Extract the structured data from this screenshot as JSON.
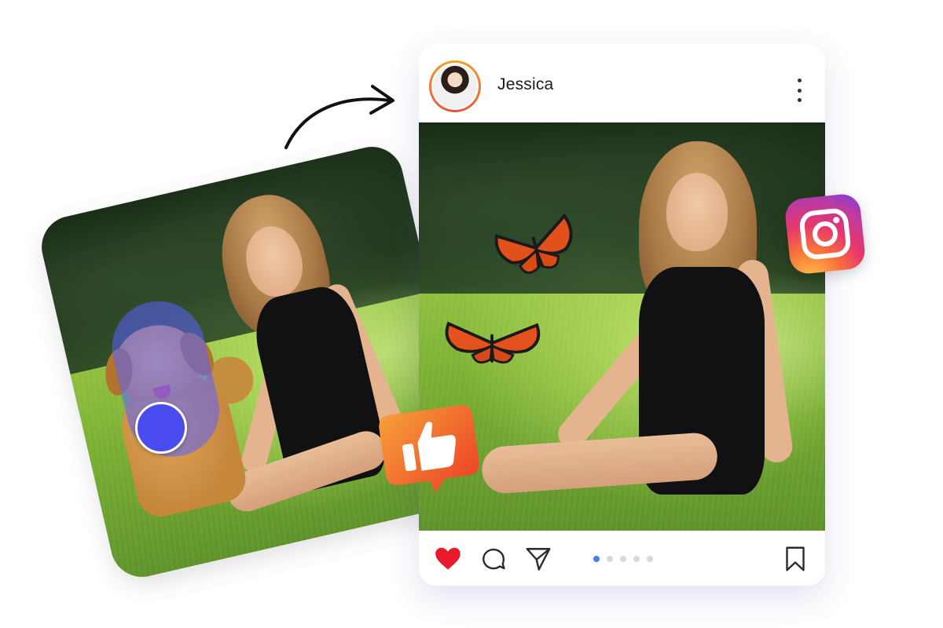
{
  "post": {
    "username": "Jessica",
    "carousel": {
      "count": 5,
      "active": 1
    }
  },
  "icons": {
    "more": "more-vertical-icon",
    "like": "heart-icon",
    "comment": "comment-icon",
    "share": "send-icon",
    "save": "bookmark-icon",
    "badge_like": "thumbs-up-icon",
    "badge_social": "instagram-icon",
    "arrow": "curved-arrow-icon"
  },
  "colors": {
    "heart": "#e8192c",
    "mask": "#5a60ff",
    "brush": "#4a4cf0",
    "dot_active": "#4a7de8",
    "dot_inactive": "#d8d8d8",
    "like_badge": "#f2552b"
  }
}
